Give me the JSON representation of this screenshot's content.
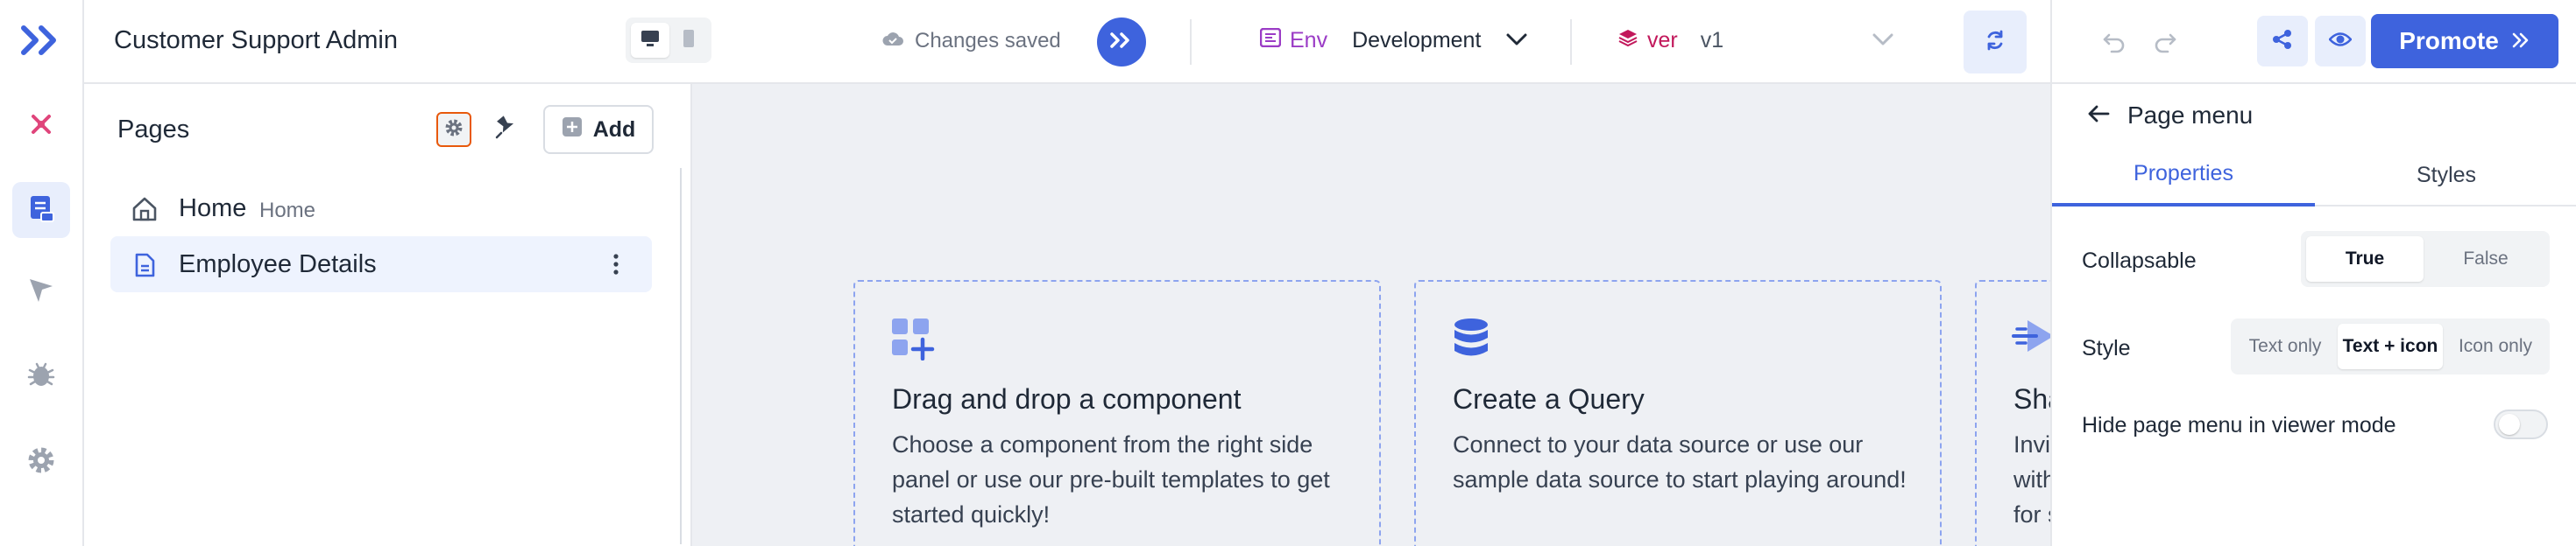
{
  "app": {
    "title": "Customer Support Admin"
  },
  "colors": {
    "accent": "#3e63dd",
    "env": "#9b3cc6",
    "version": "#c2185b",
    "highlight": "#e8590c"
  },
  "topbar": {
    "save_status": "Changes saved",
    "env_label": "Env",
    "env_value": "Development",
    "version_label": "ver",
    "version_value": "v1",
    "promote_label": "Promote",
    "icons": [
      "desktop-icon",
      "mobile-icon",
      "cloud-icon",
      "forward-icon",
      "env-icon",
      "chevron-down-icon",
      "layers-icon",
      "sync-icon",
      "undo-icon",
      "redo-icon",
      "share-icon",
      "eye-icon",
      "double-chevron-right-icon"
    ]
  },
  "rail": {
    "items": [
      "logo-icon",
      "bug-icon",
      "pages-icon",
      "cursor-icon",
      "debugger-icon",
      "settings-icon"
    ]
  },
  "pages": {
    "title": "Pages",
    "add_label": "Add",
    "items": [
      {
        "name": "Home",
        "handle": "Home",
        "icon": "home-icon"
      },
      {
        "name": "Employee Details",
        "handle": "",
        "icon": "document-icon"
      }
    ]
  },
  "canvas": {
    "cards": [
      {
        "title": "Drag and drop a component",
        "description": "Choose a component from the right side panel or use our pre-built templates to get started quickly!",
        "icon": "components-icon"
      },
      {
        "title": "Create a Query",
        "description": "Connect to your data source or use our sample data source to start playing around!",
        "icon": "database-icon"
      },
      {
        "title": "Sha",
        "description": "Invi with for s",
        "icon": "share-send-icon"
      }
    ]
  },
  "properties": {
    "back_label": "Page menu",
    "tabs": [
      "Properties",
      "Styles"
    ],
    "collapsable_label": "Collapsable",
    "collapsable_options": [
      "True",
      "False"
    ],
    "style_label": "Style",
    "style_options": [
      "Text only",
      "Text + icon",
      "Icon only"
    ],
    "hide_label": "Hide page menu in viewer mode",
    "hide_value": false
  }
}
